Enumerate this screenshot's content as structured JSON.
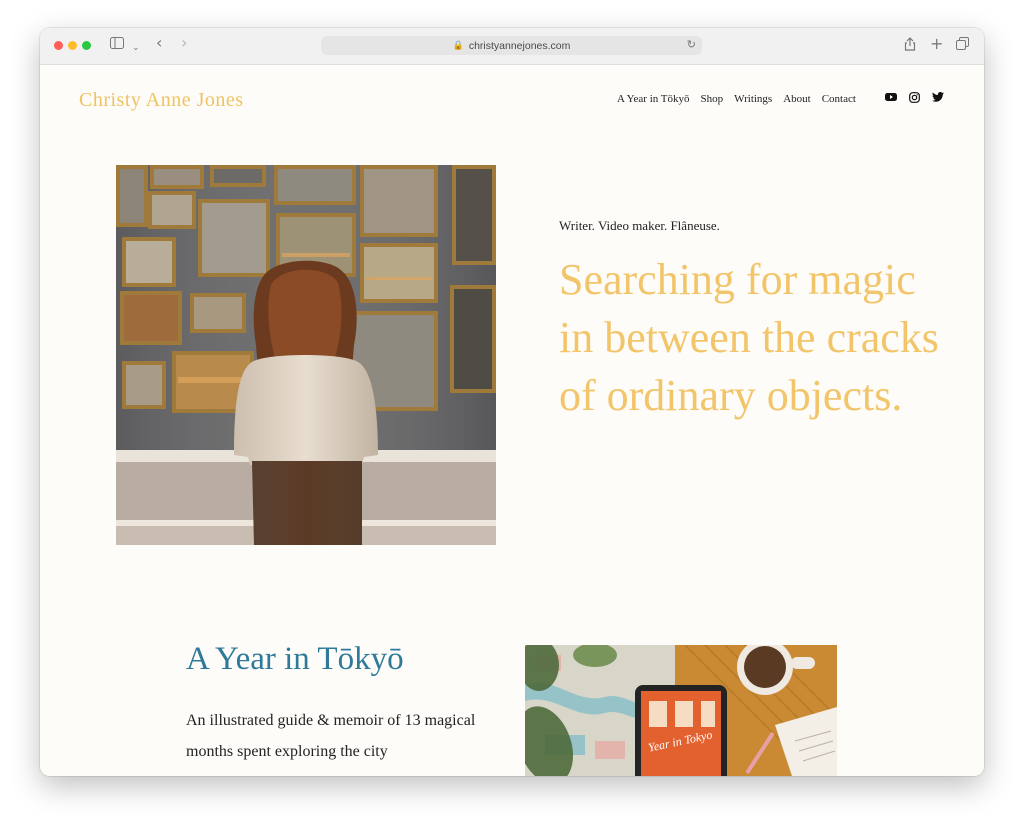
{
  "browser": {
    "url": "christyannejones.com"
  },
  "site": {
    "brand": "Christy Anne Jones",
    "nav": [
      "A Year in Tōkyō",
      "Shop",
      "Writings",
      "About",
      "Contact"
    ]
  },
  "hero": {
    "tagline": "Writer. Video maker. Flâneuse.",
    "headline": "Searching for magic in between the cracks of ordinary objects."
  },
  "feature": {
    "title": "A Year in Tōkyō",
    "body": "An illustrated guide & memoir of 13 magical months spent exploring the city",
    "book_cover_title": "Year in Tokyo"
  },
  "colors": {
    "brand_yellow": "#f3c56a",
    "title_blue": "#2f7a9a",
    "page_bg": "#fdfcf8"
  }
}
